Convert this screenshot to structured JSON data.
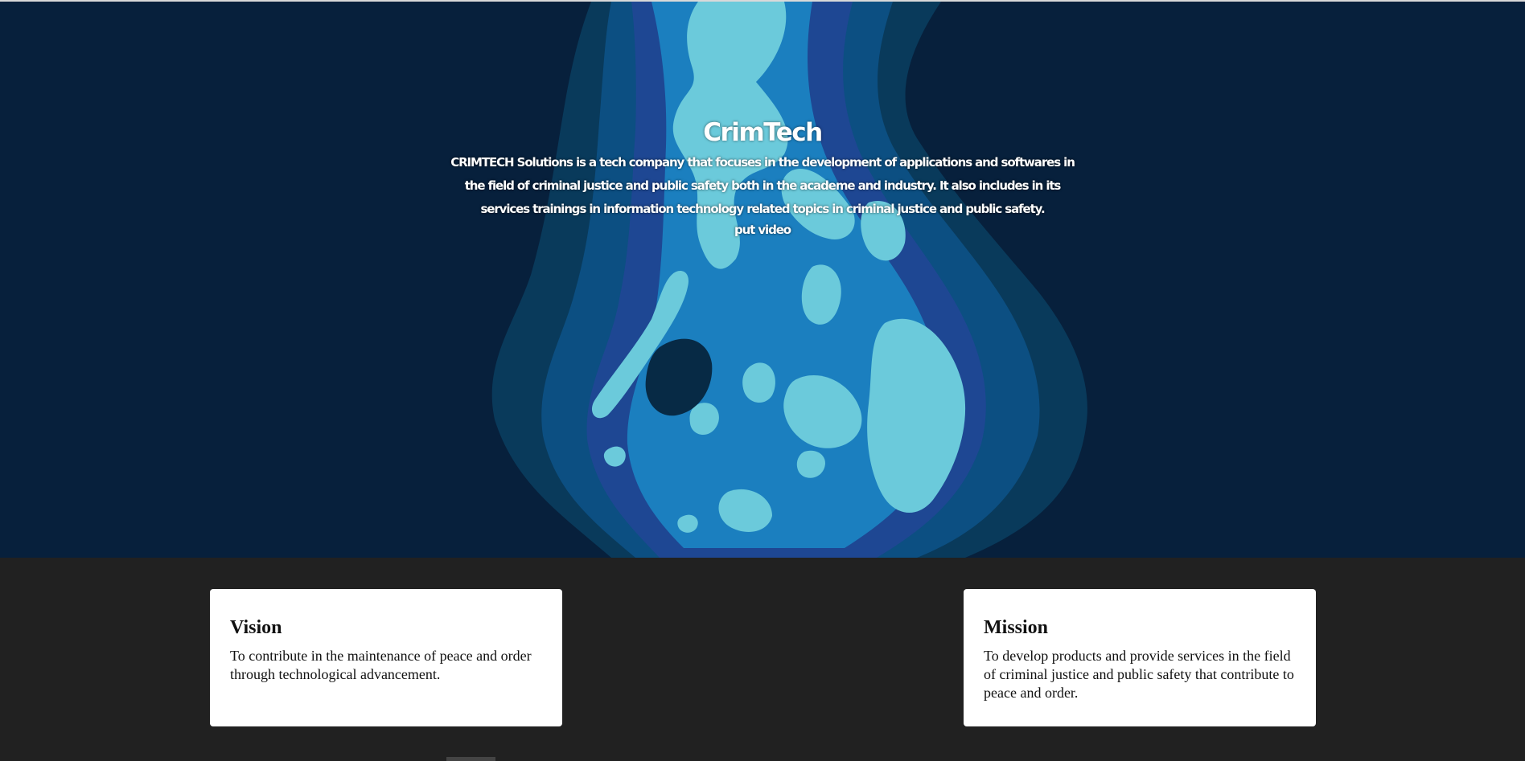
{
  "hero": {
    "title": "CrimTech",
    "description": "CRIMTECH Solutions is a tech company that focuses in the development of applications and softwares in the field of criminal justice and public safety both in the academe and industry. It also includes in its services trainings in information technology related topics in criminal justice and public safety.",
    "note": "put video"
  },
  "cards": {
    "vision": {
      "heading": "Vision",
      "text": "To contribute in the maintenance of peace and order through technological advancement."
    },
    "mission": {
      "heading": "Mission",
      "text": "To develop products and provide services in the field of criminal justice and public safety that contribute to peace and order."
    }
  },
  "colors": {
    "hero_background": "#07203c",
    "section_background": "#212121",
    "map_outer": "#093a5b",
    "map_mid": "#0e5d96",
    "map_band": "#1e4793",
    "map_inner": "#1b7fbf",
    "map_land": "#6bcadb"
  }
}
